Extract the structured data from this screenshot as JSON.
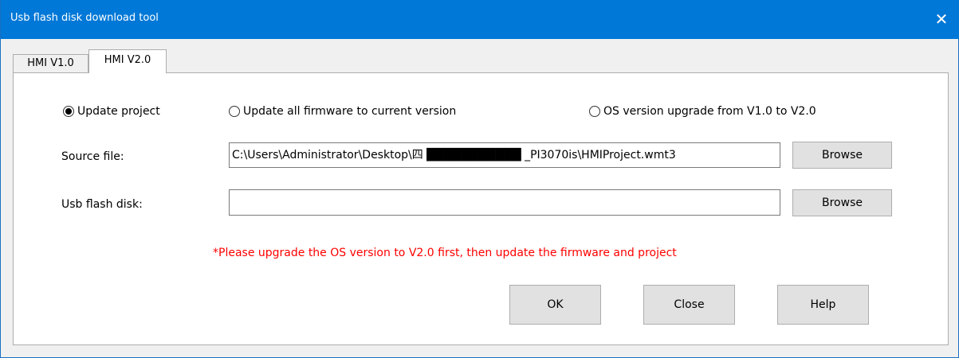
{
  "window": {
    "title": "Usb flash disk download tool",
    "close_glyph": "✕"
  },
  "tabs": [
    {
      "label": "HMI V1.0",
      "active": false
    },
    {
      "label": "HMI V2.0",
      "active": true
    }
  ],
  "options": {
    "update_project": {
      "label": "Update project",
      "checked": true
    },
    "update_firmware": {
      "label": "Update all firmware to current version",
      "checked": false
    },
    "os_upgrade": {
      "label": "OS version upgrade from V1.0 to V2.0",
      "checked": false
    }
  },
  "source": {
    "label": "Source file:",
    "value": "C:\\Users\\Administrator\\Desktop\\四 ███████████ _PI3070is\\HMIProject.wmt3",
    "browse_label": "Browse"
  },
  "usb": {
    "label": "Usb flash disk:",
    "value": "",
    "browse_label": "Browse"
  },
  "warning": "*Please upgrade the OS version to V2.0 first, then update the firmware and project",
  "buttons": {
    "ok": "OK",
    "close": "Close",
    "help": "Help"
  },
  "colors": {
    "titlebar": "#0078d7",
    "warning": "#ff0000"
  }
}
